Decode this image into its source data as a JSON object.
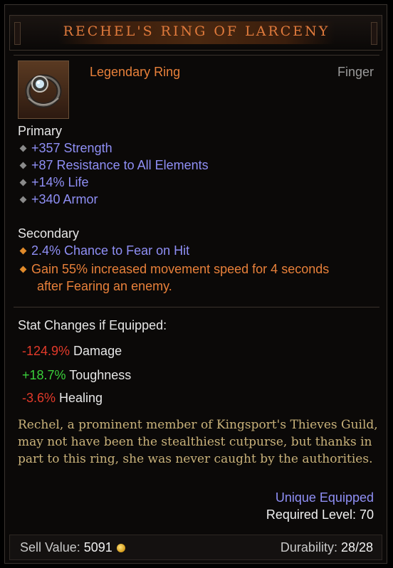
{
  "item": {
    "name": "RECHEL'S RING OF LARCENY",
    "type": "Legendary Ring",
    "slot": "Finger",
    "icon": "ring-icon"
  },
  "primary": {
    "heading": "Primary",
    "affixes": [
      "+357 Strength",
      "+87 Resistance to All Elements",
      "+14% Life",
      "+340 Armor"
    ]
  },
  "secondary": {
    "heading": "Secondary",
    "affixes": [
      "2.4% Chance to Fear on Hit"
    ],
    "legendary_line1": "Gain 55% increased movement speed for 4 seconds",
    "legendary_line2": "after Fearing an enemy."
  },
  "stat_changes": {
    "heading": "Stat Changes if Equipped:",
    "rows": [
      {
        "value": "-124.9%",
        "label": " Damage",
        "sign": "neg"
      },
      {
        "value": "+18.7%",
        "label": " Toughness",
        "sign": "pos"
      },
      {
        "value": "-3.6%",
        "label": " Healing",
        "sign": "neg"
      }
    ]
  },
  "flavor_text": "Rechel, a prominent member of Kingsport's Thieves Guild, may not have been the stealthiest cutpurse, but thanks in part to this ring, she was never caught by the authorities.",
  "unique_equipped": "Unique Equipped",
  "required_level": "Required Level: 70",
  "footer": {
    "sell_label": "Sell Value: ",
    "sell_value": "5091",
    "durability_label": "Durability: ",
    "durability_value": "28/28"
  },
  "colors": {
    "legendary": "#e8803a",
    "magic_affix": "#8f8ff5",
    "negative": "#e23a2a",
    "positive": "#3ad03a",
    "flavor": "#c9b27a"
  }
}
